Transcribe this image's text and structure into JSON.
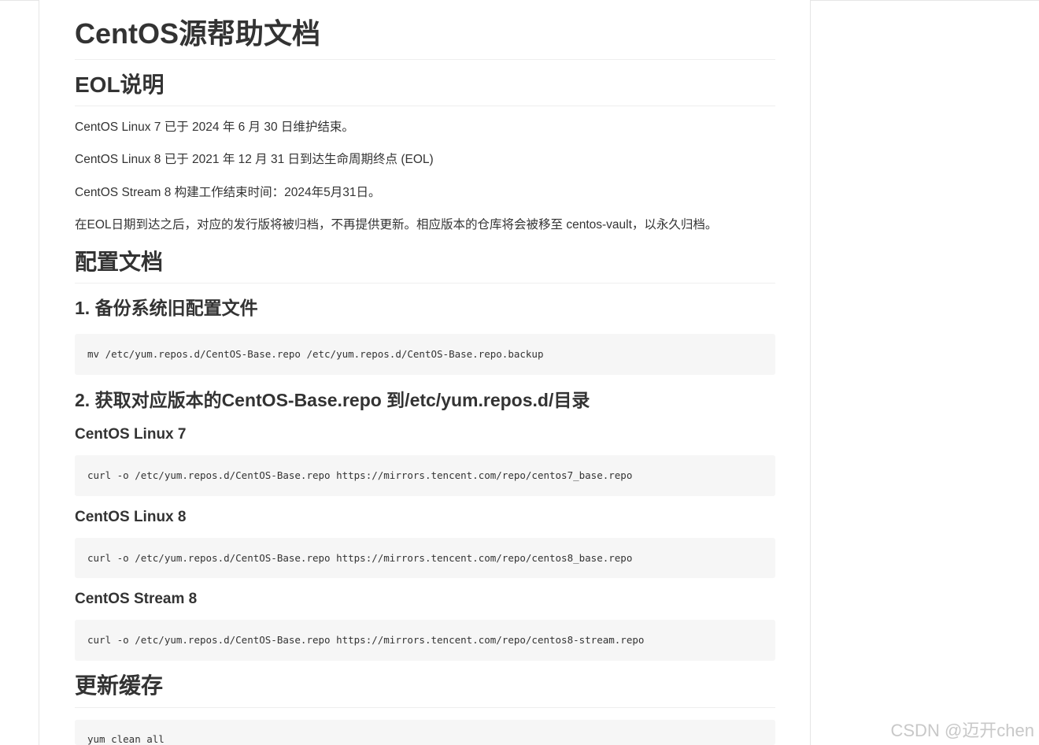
{
  "doc": {
    "title": "CentOS源帮助文档",
    "sections": {
      "eol": {
        "heading": "EOL说明",
        "paragraphs": [
          "CentOS Linux 7 已于 2024 年 6 月 30 日维护结束。",
          "CentOS Linux 8 已于 2021 年 12 月 31 日到达生命周期终点 (EOL)",
          "CentOS Stream 8 构建工作结束时间：2024年5月31日。",
          "在EOL日期到达之后，对应的发行版将被归档，不再提供更新。相应版本的仓库将会被移至 centos-vault，以永久归档。"
        ]
      },
      "config": {
        "heading": "配置文档",
        "step1": {
          "heading": "1. 备份系统旧配置文件",
          "code": "mv /etc/yum.repos.d/CentOS-Base.repo /etc/yum.repos.d/CentOS-Base.repo.backup"
        },
        "step2": {
          "heading": "2. 获取对应版本的CentOS-Base.repo 到/etc/yum.repos.d/目录",
          "versions": [
            {
              "name": "CentOS Linux 7",
              "code": "curl -o /etc/yum.repos.d/CentOS-Base.repo https://mirrors.tencent.com/repo/centos7_base.repo"
            },
            {
              "name": "CentOS Linux 8",
              "code": "curl -o /etc/yum.repos.d/CentOS-Base.repo https://mirrors.tencent.com/repo/centos8_base.repo"
            },
            {
              "name": "CentOS Stream 8",
              "code": "curl -o /etc/yum.repos.d/CentOS-Base.repo https://mirrors.tencent.com/repo/centos8-stream.repo"
            }
          ]
        }
      },
      "cache": {
        "heading": "更新缓存",
        "code": "yum clean all"
      }
    }
  },
  "watermark": "CSDN @迈开chen",
  "colors": {
    "text": "#333333",
    "code_bg": "#f6f6f6",
    "rule": "#eeeeee",
    "panel_border": "#e5e5e5"
  }
}
